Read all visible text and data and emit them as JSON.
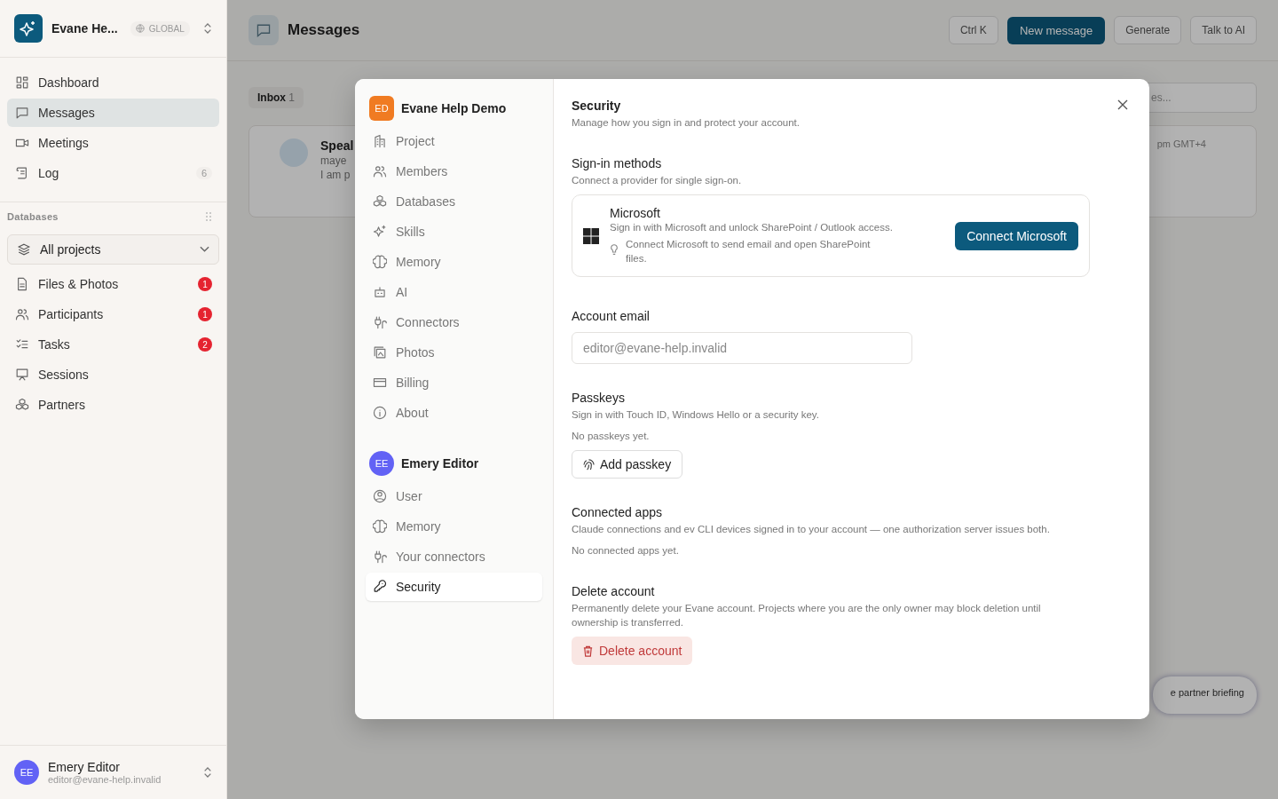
{
  "sidebar": {
    "workspace": "Evane He...",
    "scope": "GLOBAL",
    "items": [
      {
        "label": "Dashboard",
        "selected": false
      },
      {
        "label": "Messages",
        "selected": true
      },
      {
        "label": "Meetings",
        "selected": false
      },
      {
        "label": "Log",
        "selected": false,
        "count": "6"
      }
    ],
    "section_label": "Databases",
    "project_select": "All projects",
    "database_items": [
      {
        "label": "Files & Photos",
        "badge": "1"
      },
      {
        "label": "Participants",
        "badge": "1"
      },
      {
        "label": "Tasks",
        "badge": "2"
      },
      {
        "label": "Sessions"
      },
      {
        "label": "Partners"
      }
    ],
    "user": {
      "initials": "EE",
      "name": "Emery Editor",
      "email": "editor@evane-help.invalid"
    }
  },
  "background": {
    "title": "Messages",
    "shortcut": "Ctrl K",
    "new_button": "New message",
    "generate_button": "Generate",
    "ai_button": "Talk to AI",
    "inbox_tab": "Inbox",
    "inbox_count": "1",
    "search_fragment": "es...",
    "card_fragments": [
      "Speal",
      "maye",
      "I am p"
    ],
    "card_time": "pm GMT+4",
    "toast_fragment": "e partner briefing"
  },
  "dialog": {
    "groups": [
      {
        "initials": "ED",
        "name": "Evane Help Demo",
        "color": "#f07b22",
        "items": [
          {
            "label": "Project",
            "selected": false
          },
          {
            "label": "Members",
            "selected": false
          },
          {
            "label": "Databases",
            "selected": false
          },
          {
            "label": "Skills",
            "selected": false
          },
          {
            "label": "Memory",
            "selected": false
          },
          {
            "label": "AI",
            "selected": false
          },
          {
            "label": "Connectors",
            "selected": false
          },
          {
            "label": "Photos",
            "selected": false
          },
          {
            "label": "Billing",
            "selected": false
          },
          {
            "label": "About",
            "selected": false
          }
        ]
      },
      {
        "initials": "EE",
        "name": "Emery Editor",
        "color": "#6262f5",
        "items": [
          {
            "label": "User",
            "selected": false
          },
          {
            "label": "Memory",
            "selected": false
          },
          {
            "label": "Your connectors",
            "selected": false
          },
          {
            "label": "Security",
            "selected": true
          }
        ]
      }
    ],
    "title": "Security",
    "subtitle": "Manage how you sign in and protect your account.",
    "signin": {
      "title": "Sign-in methods",
      "subtitle": "Connect a provider for single sign-on.",
      "provider": "Microsoft",
      "provider_text": "Sign in with Microsoft and unlock SharePoint / Outlook access.",
      "hint": "Connect Microsoft to send email and open SharePoint files.",
      "button": "Connect Microsoft"
    },
    "email": {
      "label": "Account email",
      "value": "editor@evane-help.invalid"
    },
    "passkeys": {
      "title": "Passkeys",
      "subtitle": "Sign in with Touch ID, Windows Hello or a security key.",
      "empty": "No passkeys yet.",
      "button": "Add passkey"
    },
    "apps": {
      "title": "Connected apps",
      "subtitle": "Claude connections and ev CLI devices signed in to your account — one authorization server issues both.",
      "empty": "No connected apps yet."
    },
    "delete": {
      "title": "Delete account",
      "subtitle": "Permanently delete your Evane account. Projects where you are the only owner may block deletion until ownership is transferred.",
      "button": "Delete account"
    }
  }
}
